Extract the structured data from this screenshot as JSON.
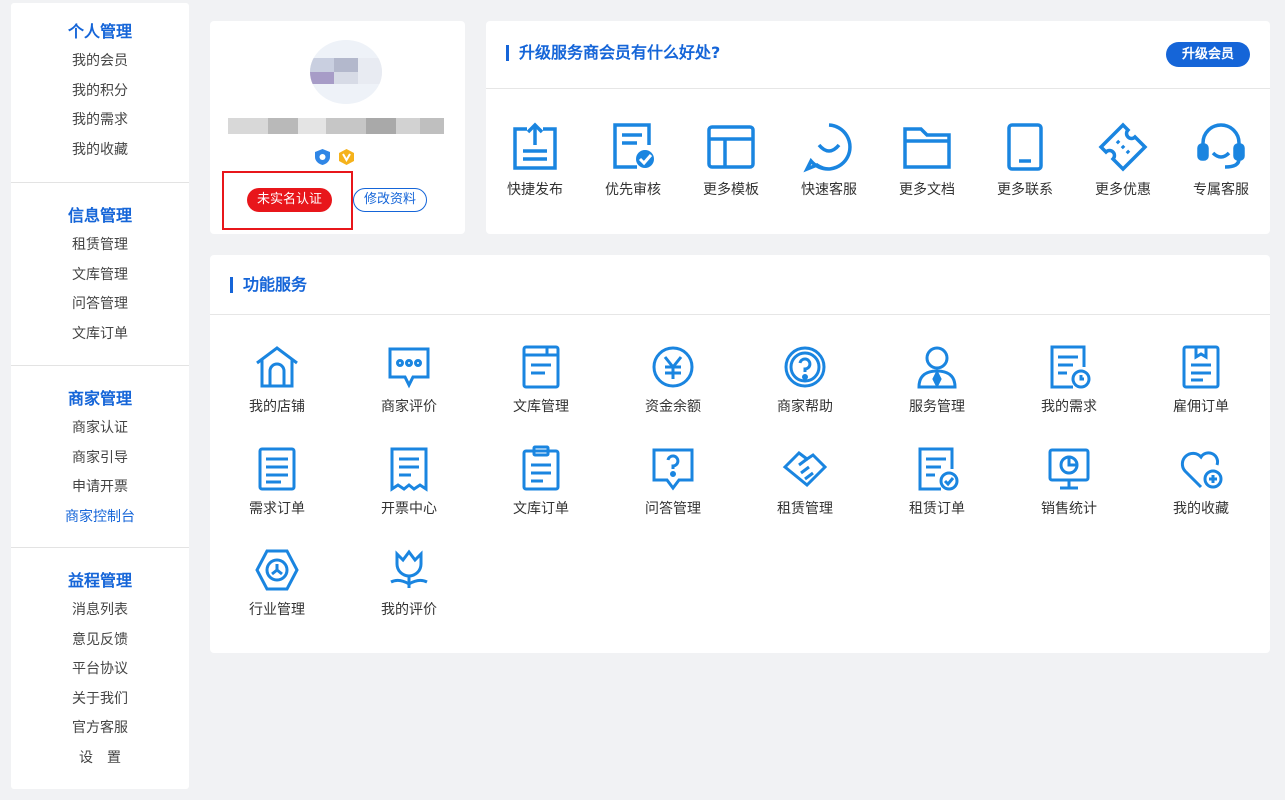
{
  "sidebar": {
    "sections": [
      {
        "title": "个人管理",
        "items": [
          "我的会员",
          "我的积分",
          "我的需求",
          "我的收藏"
        ]
      },
      {
        "title": "信息管理",
        "items": [
          "租赁管理",
          "文库管理",
          "问答管理",
          "文库订单"
        ]
      },
      {
        "title": "商家管理",
        "items": [
          "商家认证",
          "商家引导",
          "申请开票",
          "商家控制台"
        ]
      },
      {
        "title": "益程管理",
        "items": [
          "消息列表",
          "意见反馈",
          "平台协议",
          "关于我们",
          "官方客服",
          "设　置"
        ]
      }
    ]
  },
  "profile": {
    "real_name_button": "未实名认证",
    "edit_button": "修改资料"
  },
  "upgrade": {
    "title": "升级服务商会员有什么好处?",
    "button": "升级会员",
    "perks": [
      {
        "label": "快捷发布",
        "icon": "quick-publish-icon"
      },
      {
        "label": "优先审核",
        "icon": "priority-review-icon"
      },
      {
        "label": "更多模板",
        "icon": "template-icon"
      },
      {
        "label": "快速客服",
        "icon": "chat-icon"
      },
      {
        "label": "更多文档",
        "icon": "folder-icon"
      },
      {
        "label": "更多联系",
        "icon": "phone-icon"
      },
      {
        "label": "更多优惠",
        "icon": "coupon-icon"
      },
      {
        "label": "专属客服",
        "icon": "headset-icon"
      }
    ]
  },
  "services": {
    "title": "功能服务",
    "items": [
      {
        "label": "我的店铺",
        "icon": "store-icon"
      },
      {
        "label": "商家评价",
        "icon": "comment-icon"
      },
      {
        "label": "文库管理",
        "icon": "library-icon"
      },
      {
        "label": "资金余额",
        "icon": "yuan-icon"
      },
      {
        "label": "商家帮助",
        "icon": "help-icon"
      },
      {
        "label": "服务管理",
        "icon": "service-person-icon"
      },
      {
        "label": "我的需求",
        "icon": "demand-icon"
      },
      {
        "label": "雇佣订单",
        "icon": "employ-order-icon"
      },
      {
        "label": "需求订单",
        "icon": "demand-order-icon"
      },
      {
        "label": "开票中心",
        "icon": "invoice-icon"
      },
      {
        "label": "文库订单",
        "icon": "library-order-icon"
      },
      {
        "label": "问答管理",
        "icon": "qa-icon"
      },
      {
        "label": "租赁管理",
        "icon": "handshake-icon"
      },
      {
        "label": "租赁订单",
        "icon": "lease-order-icon"
      },
      {
        "label": "销售统计",
        "icon": "sales-stats-icon"
      },
      {
        "label": "我的收藏",
        "icon": "favorite-icon"
      },
      {
        "label": "行业管理",
        "icon": "industry-icon"
      },
      {
        "label": "我的评价",
        "icon": "flower-icon"
      }
    ]
  },
  "colors": {
    "accent": "#1565d8",
    "alert": "#e8161b"
  }
}
